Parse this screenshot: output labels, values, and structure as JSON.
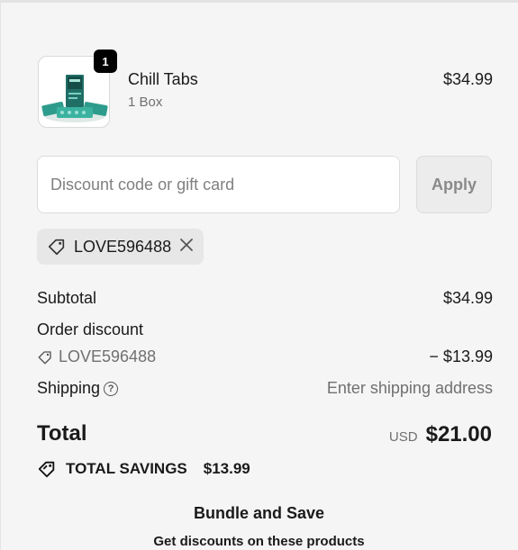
{
  "cart": {
    "item": {
      "quantity": "1",
      "title": "Chill Tabs",
      "variant": "1 Box",
      "price": "$34.99",
      "icon": "product-box-image"
    }
  },
  "discount": {
    "placeholder": "Discount code or gift card",
    "apply_label": "Apply",
    "applied_code": "LOVE596488",
    "icons": {
      "tag": "tag-icon",
      "remove": "close-icon"
    }
  },
  "summary": {
    "subtotal_label": "Subtotal",
    "subtotal_value": "$34.99",
    "order_discount_label": "Order discount",
    "discount_code": "LOVE596488",
    "discount_value": "− $13.99",
    "shipping_label": "Shipping",
    "shipping_value": "Enter shipping address",
    "total_label": "Total",
    "currency": "USD",
    "total_value": "$21.00",
    "savings_label": "TOTAL SAVINGS",
    "savings_value": "$13.99"
  },
  "bundle": {
    "title": "Bundle and Save",
    "subtitle": "Get discounts on these products"
  },
  "colors": {
    "background": "#f5f5f5",
    "badge": "#000000",
    "product_teal": "#2a9d8f"
  }
}
